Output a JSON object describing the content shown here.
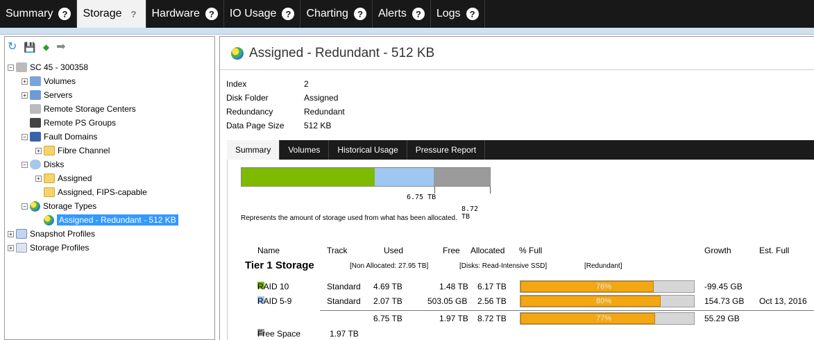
{
  "top_tabs": [
    {
      "label": "Summary",
      "active": false
    },
    {
      "label": "Storage",
      "active": true
    },
    {
      "label": "Hardware",
      "active": false
    },
    {
      "label": "IO Usage",
      "active": false
    },
    {
      "label": "Charting",
      "active": false
    },
    {
      "label": "Alerts",
      "active": false
    },
    {
      "label": "Logs",
      "active": false
    }
  ],
  "help_glyph": "?",
  "left_toolbar": {
    "refresh_icon": "↻",
    "save_icon": "💾",
    "back_icon": "◆",
    "forward_icon": "➡"
  },
  "tree": {
    "expand_collapsed": "+",
    "expand_open": "−",
    "items": [
      {
        "label": "SC 45 - 300358"
      },
      {
        "label": "Volumes"
      },
      {
        "label": "Servers"
      },
      {
        "label": "Remote Storage Centers"
      },
      {
        "label": "Remote PS Groups"
      },
      {
        "label": "Fault Domains"
      },
      {
        "label": "Fibre Channel"
      },
      {
        "label": "Disks"
      },
      {
        "label": "Assigned"
      },
      {
        "label": "Assigned, FIPS-capable"
      },
      {
        "label": "Storage Types"
      },
      {
        "label": "Assigned - Redundant - 512 KB"
      },
      {
        "label": "Snapshot Profiles"
      },
      {
        "label": "Storage Profiles"
      }
    ]
  },
  "detail": {
    "title": "Assigned - Redundant - 512 KB",
    "properties": [
      {
        "key": "Index",
        "value": "2"
      },
      {
        "key": "Disk Folder",
        "value": "Assigned"
      },
      {
        "key": "Redundancy",
        "value": "Redundant"
      },
      {
        "key": "Data Page Size",
        "value": "512 KB"
      }
    ],
    "sub_tabs": [
      {
        "label": "Summary",
        "active": true
      },
      {
        "label": "Volumes",
        "active": false
      },
      {
        "label": "Historical Usage",
        "active": false
      },
      {
        "label": "Pressure Report",
        "active": false
      }
    ]
  },
  "allocation_bar": {
    "segments": [
      {
        "name": "RAID 10",
        "value_tb": 4.69,
        "color": "#7dba00"
      },
      {
        "name": "RAID 5-9",
        "value_tb": 2.07,
        "color": "#9ec8f2"
      },
      {
        "name": "Free",
        "value_tb": 1.97,
        "color": "#9b9b9b"
      }
    ],
    "used_label": "6.75 TB",
    "allocated_label": "8.72 TB",
    "caption": "Represents the amount of storage used from what has been allocated."
  },
  "table": {
    "headers": {
      "name": "Name",
      "track": "Track",
      "used": "Used",
      "free": "Free",
      "allocated": "Allocated",
      "pct_full": "% Full",
      "growth": "Growth",
      "est_full": "Est. Full"
    },
    "tier": {
      "name": "Tier 1 Storage",
      "non_allocated": "[Non Allocated: 27.95 TB]",
      "disks": "[Disks: Read-Intensive SSD]",
      "redundancy": "[Redundant]"
    },
    "rows": [
      {
        "name": "RAID 10",
        "color": "#7dba00",
        "track": "Standard",
        "used": "4.69 TB",
        "free": "1.48 TB",
        "allocated": "6.17 TB",
        "pct": "76%",
        "pct_value": 76,
        "growth": "-99.45 GB",
        "est_full": ""
      },
      {
        "name": "RAID 5-9",
        "color": "#9ec8f2",
        "track": "Standard",
        "used": "2.07 TB",
        "free": "503.05 GB",
        "allocated": "2.56 TB",
        "pct": "80%",
        "pct_value": 80,
        "growth": "154.73 GB",
        "est_full": "Oct 13, 2016"
      }
    ],
    "total": {
      "used": "6.75 TB",
      "free": "1.97 TB",
      "allocated": "8.72 TB",
      "pct": "77%",
      "pct_value": 77,
      "growth": "55.29 GB"
    },
    "free_space": {
      "label": "Free Space",
      "color": "#9b9b9b",
      "value": "1.97 TB"
    }
  }
}
